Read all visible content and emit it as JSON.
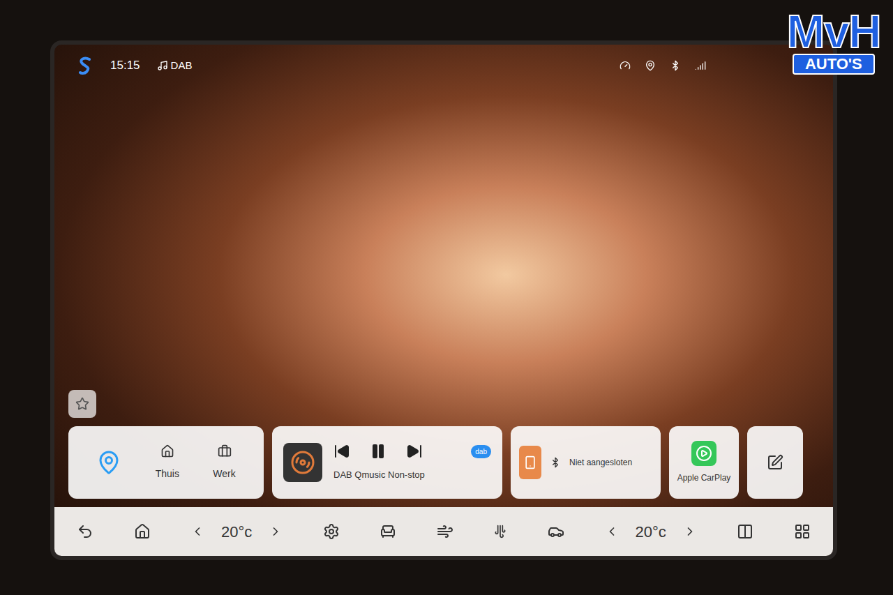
{
  "status_bar": {
    "time": "15:15",
    "source": "DAB"
  },
  "logo": {
    "top": "MvH",
    "bottom": "AUTO'S"
  },
  "navigation": {
    "shortcuts": [
      "Thuis",
      "Werk"
    ]
  },
  "media": {
    "station": "DAB Qmusic Non-stop",
    "badge": "dab",
    "playing": true
  },
  "bluetooth": {
    "status": "Niet aangesloten"
  },
  "carplay": {
    "label": "Apple CarPlay"
  },
  "climate": {
    "driver_temp": "20°c",
    "passenger_temp": "20°c"
  }
}
